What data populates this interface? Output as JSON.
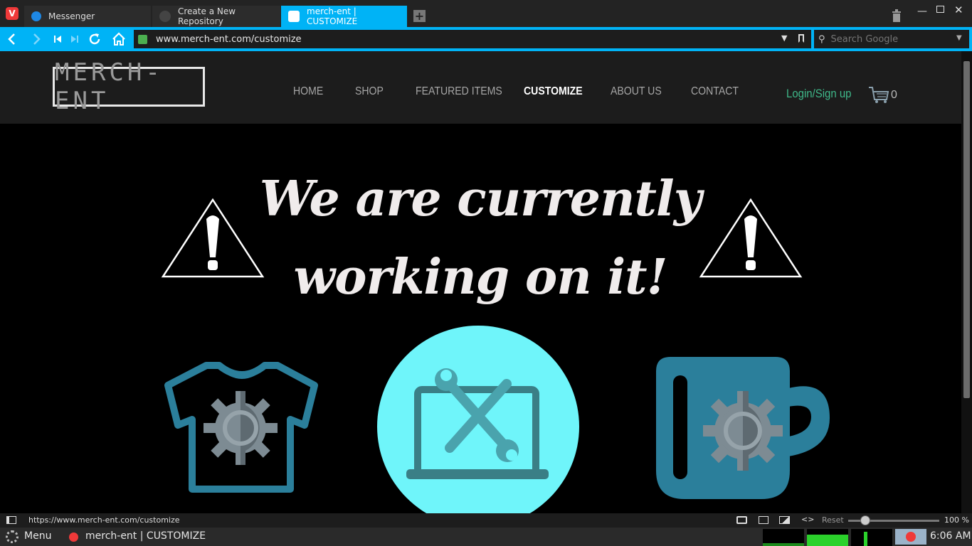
{
  "browser": {
    "tabs": [
      {
        "label": "Messenger"
      },
      {
        "label": "Create a New Repository"
      },
      {
        "label": "merch-ent | CUSTOMIZE"
      }
    ],
    "address": "www.merch-ent.com/customize",
    "search_placeholder": "Search Google",
    "status_url": "https://www.merch-ent.com/customize",
    "reset_label": "Reset",
    "zoom": "100 %"
  },
  "site": {
    "logo": "MERCH-ENT",
    "nav": [
      "HOME",
      "SHOP",
      "FEATURED ITEMS",
      "CUSTOMIZE",
      "ABOUT US",
      "CONTACT"
    ],
    "active_nav": "CUSTOMIZE",
    "login": "Login/Sign up",
    "cart_count": "0",
    "headline_line1": "We are currently",
    "headline_line2": "working on it!"
  },
  "taskbar": {
    "menu": "Menu",
    "window": "merch-ent | CUSTOMIZE",
    "clock": "6:06 AM"
  },
  "colors": {
    "accent": "#00b3f6",
    "login": "#3fb98a",
    "circle": "#6ff5fa",
    "icon_blue": "#2b7f9b"
  }
}
